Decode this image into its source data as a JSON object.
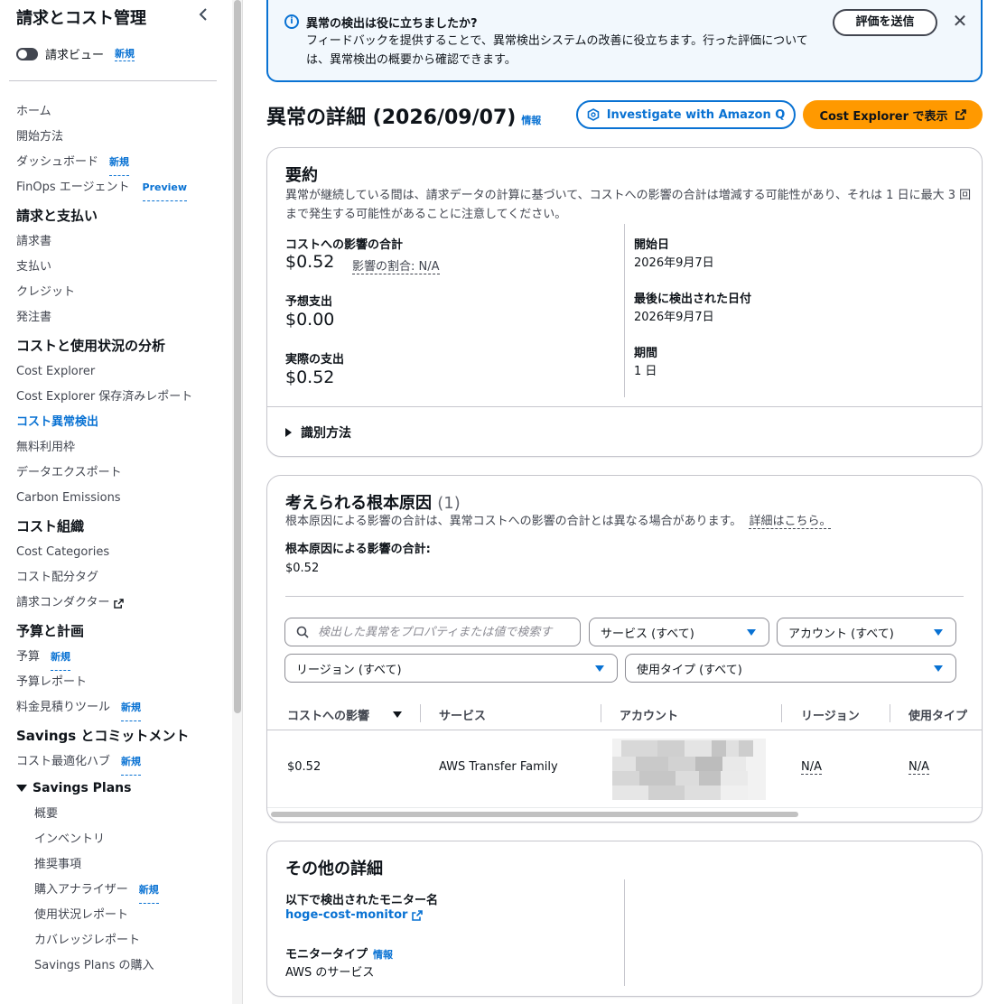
{
  "sidebar": {
    "title": "請求とコスト管理",
    "toggle_label": "請求ビュー",
    "new_badge": "新規",
    "preview_badge": "Preview",
    "home": "ホーム",
    "getting_started": "開始方法",
    "dashboard": "ダッシュボード",
    "finops_agent": "FinOps エージェント",
    "billing_heading": "請求と支払い",
    "bills": "請求書",
    "payments": "支払い",
    "credits": "クレジット",
    "purchase_orders": "発注書",
    "analysis_heading": "コストと使用状況の分析",
    "cost_explorer": "Cost Explorer",
    "saved_reports": "Cost Explorer 保存済みレポート",
    "anomaly_detection": "コスト異常検出",
    "free_tier": "無料利用枠",
    "data_exports": "データエクスポート",
    "carbon_emissions": "Carbon Emissions",
    "org_heading": "コスト組織",
    "cost_categories": "Cost Categories",
    "cost_allocation_tags": "コスト配分タグ",
    "billing_conductor": "請求コンダクター",
    "budget_heading": "予算と計画",
    "budgets": "予算",
    "budget_reports": "予算レポート",
    "pricing_calculator": "料金見積りツール",
    "savings_heading": "Savings とコミットメント",
    "cost_optimization_hub": "コスト最適化ハブ",
    "savings_plans_group": "Savings Plans",
    "sp_overview": "概要",
    "sp_inventory": "インベントリ",
    "sp_recommendations": "推奨事項",
    "sp_purchase_analyzer": "購入アナライザー",
    "sp_utilization": "使用状況レポート",
    "sp_coverage": "カバレッジレポート",
    "sp_purchase": "Savings Plans の購入"
  },
  "flash": {
    "title": "異常の検出は役に立ちましたか?",
    "body": "フィードバックを提供することで、異常検出システムの改善に役立ちます。行った評価については、異常検出の概要から確認できます。",
    "submit_label": "評価を送信"
  },
  "header": {
    "title": "異常の詳細 (2026/09/07)",
    "info": "情報",
    "investigate_label": "Investigate with Amazon Q",
    "cost_explorer_label": "Cost Explorer で表示"
  },
  "summary": {
    "title": "要約",
    "description": "異常が継続している間は、請求データの計算に基づいて、コストへの影響の合計は増減する可能性があり、それは 1 日に最大 3 回まで発生する可能性があることに注意してください。",
    "total_impact_label": "コストへの影響の合計",
    "total_impact_value": "$0.52",
    "impact_ratio": "影響の割合: N/A",
    "expected_label": "予想支出",
    "expected_value": "$0.00",
    "actual_label": "実際の支出",
    "actual_value": "$0.52",
    "start_label": "開始日",
    "start_value": "2026年9月7日",
    "last_detected_label": "最後に検出された日付",
    "last_detected_value": "2026年9月7日",
    "duration_label": "期間",
    "duration_value": "1 日",
    "identification_label": "識別方法"
  },
  "root_causes": {
    "title": "考えられる根本原因",
    "count": "(1)",
    "description": "根本原因による影響の合計は、異常コストへの影響の合計とは異なる場合があります。",
    "learn_more": "詳細はこちら。",
    "total_label": "根本原因による影響の合計:",
    "total_value": "$0.52",
    "search_placeholder": "検出した異常をプロパティまたは値で検索す",
    "filter_service": "サービス (すべて)",
    "filter_account": "アカウント (すべて)",
    "filter_region": "リージョン (すべて)",
    "filter_usage": "使用タイプ (すべて)",
    "columns": [
      "コストへの影響",
      "サービス",
      "アカウント",
      "リージョン",
      "使用タイプ"
    ],
    "rows": [
      {
        "impact": "$0.52",
        "service": "AWS Transfer Family",
        "region": "N/A",
        "usage": "N/A"
      }
    ]
  },
  "other_details": {
    "title": "その他の詳細",
    "monitor_name_label": "以下で検出されたモニター名",
    "monitor_name_value": "hoge-cost-monitor",
    "monitor_type_label": "モニタータイプ",
    "monitor_type_info": "情報",
    "monitor_type_value": "AWS のサービス"
  },
  "colors": {
    "accent": "#0972d3",
    "primary_button": "#ff9900",
    "flash_bg": "#f2f8fd"
  }
}
